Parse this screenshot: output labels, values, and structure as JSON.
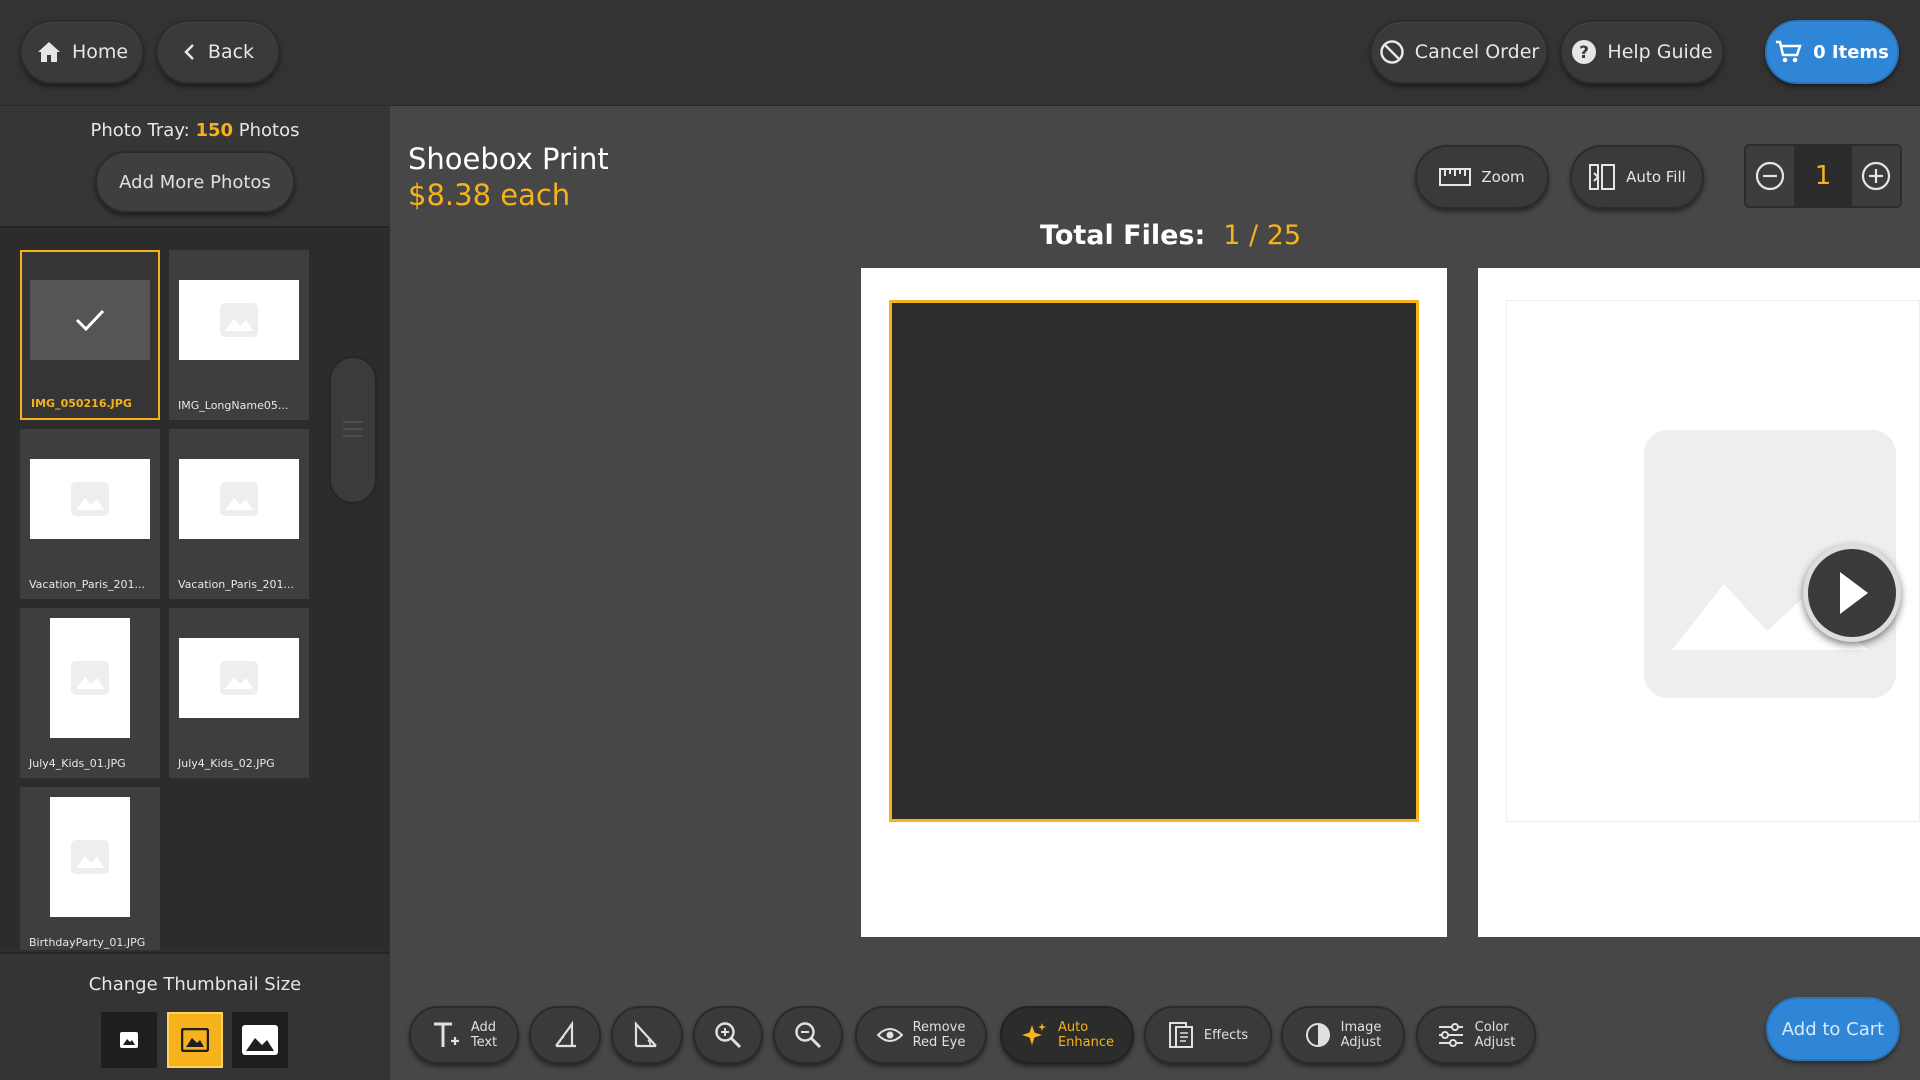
{
  "header": {
    "home_label": "Home",
    "back_label": "Back",
    "cancel_label": "Cancel Order",
    "help_label": "Help Guide",
    "cart_label": "0 Items"
  },
  "tray": {
    "label_prefix": "Photo Tray:",
    "count": "150",
    "label_suffix": "Photos",
    "add_more_label": "Add More Photos",
    "photos": [
      {
        "name": "IMG_050216.JPG",
        "selected": true
      },
      {
        "name": "IMG_LongName05...",
        "selected": false
      },
      {
        "name": "Vacation_Paris_201...",
        "selected": false
      },
      {
        "name": "Vacation_Paris_201...",
        "selected": false
      },
      {
        "name": "July4_Kids_01.JPG",
        "selected": false
      },
      {
        "name": "July4_Kids_02.JPG",
        "selected": false
      },
      {
        "name": "BirthdayParty_01.JPG",
        "selected": false
      }
    ],
    "thumb_size_label": "Change Thumbnail Size",
    "thumb_size_selected": "medium"
  },
  "product": {
    "title": "Shoebox Print",
    "price": "$8.38 each"
  },
  "tools": {
    "zoom_label": "Zoom",
    "autofill_label": "Auto Fill"
  },
  "quantity": {
    "value": "1"
  },
  "files": {
    "label": "Total Files:",
    "value": "1 / 25"
  },
  "toolbar": {
    "add_text": [
      "Add",
      "Text"
    ],
    "remove_red_eye": [
      "Remove",
      "Red Eye"
    ],
    "auto_enhance": [
      "Auto",
      "Enhance"
    ],
    "effects": "Effects",
    "image_adjust": [
      "Image",
      "Adjust"
    ],
    "color_adjust": [
      "Color",
      "Adjust"
    ],
    "add_to_cart": "Add to Cart"
  },
  "colors": {
    "accent": "#f5b21c",
    "primary_blue": "#2f86d6",
    "background": "#474747"
  }
}
